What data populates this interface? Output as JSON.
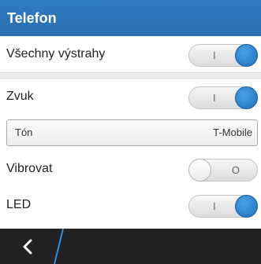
{
  "header": {
    "title": "Telefon"
  },
  "settings": {
    "all_alerts": {
      "label": "Všechny výstrahy",
      "toggle_mark": "I",
      "on": true
    },
    "sound": {
      "label": "Zvuk",
      "toggle_mark": "I",
      "on": true
    },
    "tone": {
      "label": "Tón",
      "value": "T-Mobile"
    },
    "vibrate": {
      "label": "Vibrovat",
      "toggle_mark": "O",
      "on": false
    },
    "led": {
      "label": "LED",
      "toggle_mark": "I",
      "on": true
    }
  },
  "bottom_bar": {
    "back_icon": "chevron-left-icon"
  },
  "colors": {
    "header": "#2f7bc1",
    "toggle_on": "#1d6fbe",
    "bottom_bar": "#222222",
    "accent_line": "#2a8fe0"
  }
}
